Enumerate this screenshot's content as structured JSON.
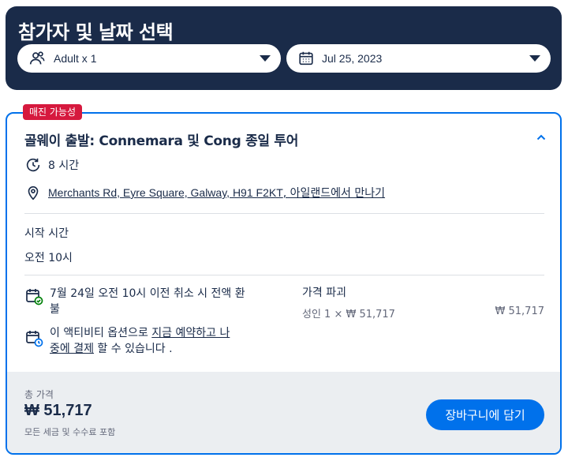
{
  "header": {
    "title": "참가자 및 날짜 선택",
    "participants_value": "Adult x 1",
    "date_value": "Jul 25, 2023"
  },
  "option": {
    "badge": "매진 가능성",
    "title": "골웨이 출발: Connemara 및 Cong 종일 투어",
    "duration": "8 시간",
    "meeting_link": "Merchants Rd, Eyre Square, Galway, H91 F2KT",
    "meeting_suffix": ", 아일랜드에서 만나기",
    "start_time_label": "시작 시간",
    "start_time_value": "오전 10시",
    "cancellation_line1": "7월 24일 오전 10시 이전 취소 시 전액 환",
    "cancellation_line2": "불",
    "reserve_prefix": "이 액티비티 옵션으로 ",
    "reserve_link_line1": "지금 예약하고 나",
    "reserve_link_line2": "중에 결제",
    "reserve_suffix": " 할 수 있습니다 .",
    "price_breakdown_label": "가격 파괴",
    "price_breakdown_item": "성인 1 × ₩ 51,717",
    "price_breakdown_amount": "₩ 51,717"
  },
  "footer": {
    "total_label": "총 가격",
    "total_value": "₩ 51,717",
    "total_note": "모든 세금 및 수수료 포함",
    "cart_button": "장바구니에 담기"
  },
  "colors": {
    "navy": "#1a2b49",
    "accent_blue": "#0071eb",
    "badge_red": "#d6193e",
    "footer_bg": "#ebeef1",
    "success_green": "#008009"
  }
}
